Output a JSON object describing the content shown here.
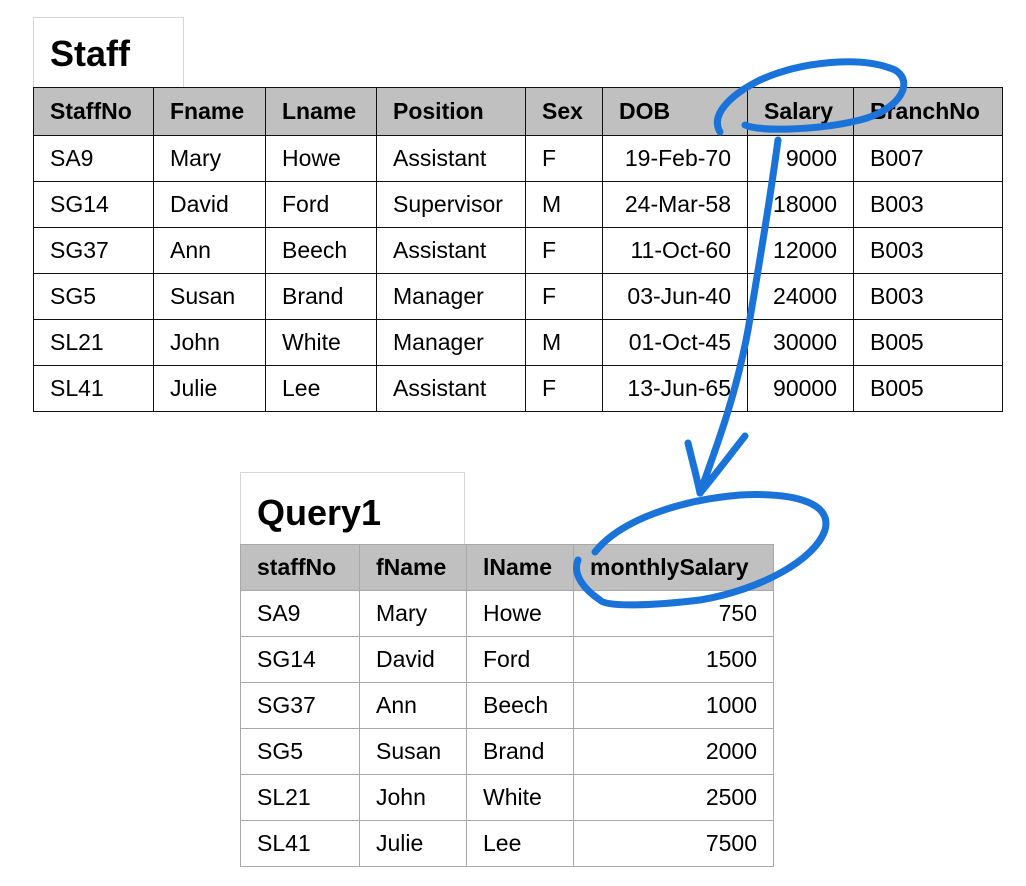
{
  "staff": {
    "title": "Staff",
    "columns": [
      "StaffNo",
      "Fname",
      "Lname",
      "Position",
      "Sex",
      "DOB",
      "Salary",
      "BranchNo"
    ],
    "rows": [
      [
        "SA9",
        "Mary",
        "Howe",
        "Assistant",
        "F",
        "19-Feb-70",
        "9000",
        "B007"
      ],
      [
        "SG14",
        "David",
        "Ford",
        "Supervisor",
        "M",
        "24-Mar-58",
        "18000",
        "B003"
      ],
      [
        "SG37",
        "Ann",
        "Beech",
        "Assistant",
        "F",
        "11-Oct-60",
        "12000",
        "B003"
      ],
      [
        "SG5",
        "Susan",
        "Brand",
        "Manager",
        "F",
        "03-Jun-40",
        "24000",
        "B003"
      ],
      [
        "SL21",
        "John",
        "White",
        "Manager",
        "M",
        "01-Oct-45",
        "30000",
        "B005"
      ],
      [
        "SL41",
        "Julie",
        "Lee",
        "Assistant",
        "F",
        "13-Jun-65",
        "90000",
        "B005"
      ]
    ]
  },
  "query": {
    "title": "Query1",
    "columns": [
      "staffNo",
      "fName",
      "lName",
      "monthlySalary"
    ],
    "rows": [
      [
        "SA9",
        "Mary",
        "Howe",
        "750"
      ],
      [
        "SG14",
        "David",
        "Ford",
        "1500"
      ],
      [
        "SG37",
        "Ann",
        "Beech",
        "1000"
      ],
      [
        "SG5",
        "Susan",
        "Brand",
        "2000"
      ],
      [
        "SL21",
        "John",
        "White",
        "2500"
      ],
      [
        "SL41",
        "Julie",
        "Lee",
        "7500"
      ]
    ]
  },
  "annotation": {
    "ink_color": "#1a73d9"
  }
}
